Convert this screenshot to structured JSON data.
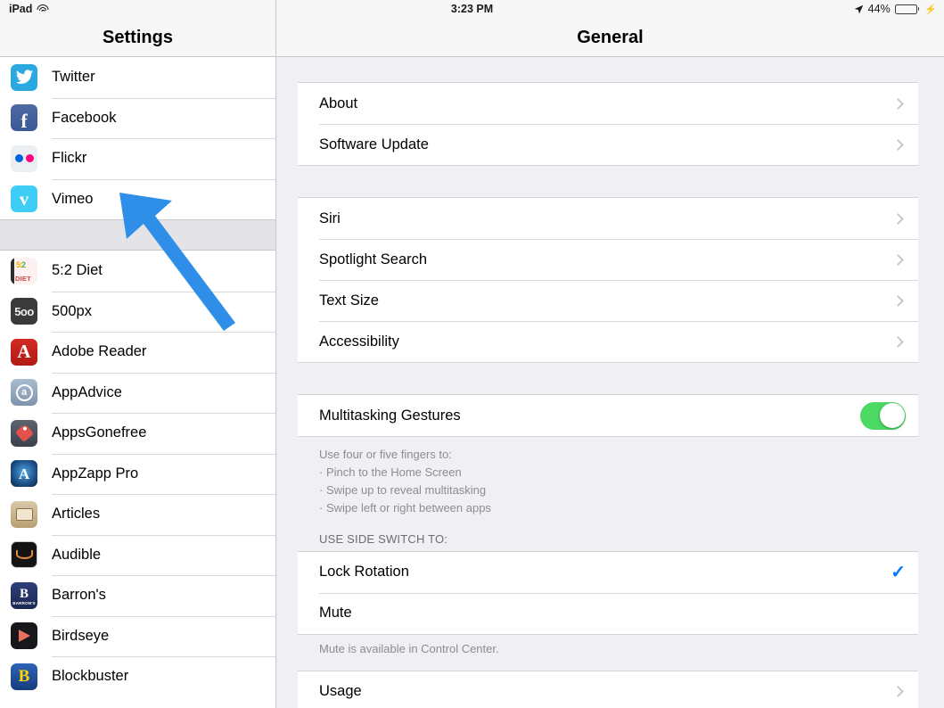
{
  "statusbar": {
    "device": "iPad",
    "wifi_icon": "wifi-icon",
    "time": "3:23 PM",
    "location_icon": "location-arrow-icon",
    "battery_percent": "44%",
    "battery_level": 44,
    "battery_icon": "battery-icon",
    "charging_icon": "lightning-bolt-icon"
  },
  "sidebar": {
    "title": "Settings",
    "social_items": [
      {
        "label": "Twitter",
        "icon": "twitter-icon"
      },
      {
        "label": "Facebook",
        "icon": "facebook-icon"
      },
      {
        "label": "Flickr",
        "icon": "flickr-icon"
      },
      {
        "label": "Vimeo",
        "icon": "vimeo-icon"
      }
    ],
    "app_items": [
      {
        "label": "5:2 Diet",
        "icon": "five-two-diet-icon"
      },
      {
        "label": "500px",
        "icon": "five-hundred-px-icon"
      },
      {
        "label": "Adobe Reader",
        "icon": "adobe-reader-icon"
      },
      {
        "label": "AppAdvice",
        "icon": "appadvice-icon"
      },
      {
        "label": "AppsGonefree",
        "icon": "appsgonefree-icon"
      },
      {
        "label": "AppZapp Pro",
        "icon": "appzapp-pro-icon"
      },
      {
        "label": "Articles",
        "icon": "articles-icon"
      },
      {
        "label": "Audible",
        "icon": "audible-icon"
      },
      {
        "label": "Barron's",
        "icon": "barrons-icon"
      },
      {
        "label": "Birdseye",
        "icon": "birdseye-icon"
      },
      {
        "label": "Blockbuster",
        "icon": "blockbuster-icon"
      }
    ]
  },
  "main": {
    "title": "General",
    "group_about": [
      {
        "label": "About",
        "accessory": "chevron"
      },
      {
        "label": "Software Update",
        "accessory": "chevron"
      }
    ],
    "group_features": [
      {
        "label": "Siri",
        "accessory": "chevron"
      },
      {
        "label": "Spotlight Search",
        "accessory": "chevron"
      },
      {
        "label": "Text Size",
        "accessory": "chevron"
      },
      {
        "label": "Accessibility",
        "accessory": "chevron"
      }
    ],
    "multitasking": {
      "label": "Multitasking Gestures",
      "toggle_on": true,
      "footer_lines": [
        "Use four or five fingers to:",
        "· Pinch to the Home Screen",
        "· Swipe up to reveal multitasking",
        "· Swipe left or right between apps"
      ]
    },
    "side_switch": {
      "header": "USE SIDE SWITCH TO:",
      "options": [
        {
          "label": "Lock Rotation",
          "selected": true
        },
        {
          "label": "Mute",
          "selected": false
        }
      ],
      "note": "Mute is available in Control Center."
    },
    "group_usage": [
      {
        "label": "Usage",
        "accessory": "chevron"
      }
    ]
  },
  "annotation": {
    "arrow_color": "#2f8fe8",
    "points_to": "Vimeo"
  },
  "colors": {
    "toggle_on": "#4CD964",
    "checkmark": "#007AFF",
    "panel_bg": "#EFEFF4",
    "card_bg": "#FFFFFF",
    "header_bg": "#F7F7F7"
  }
}
